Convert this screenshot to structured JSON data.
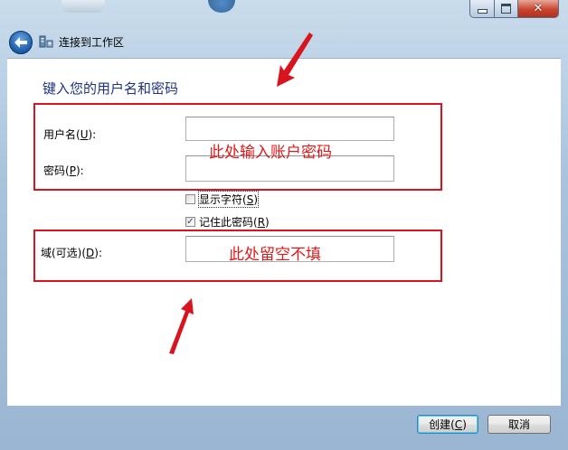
{
  "window": {
    "title": "连接到工作区",
    "controls": [
      "minimize",
      "maximize",
      "close"
    ]
  },
  "form": {
    "heading": "键入您的用户名和密码",
    "username": {
      "label_pre": "用户名(",
      "accel": "U",
      "label_post": "):",
      "value": ""
    },
    "password": {
      "label_pre": "密码(",
      "accel": "P",
      "label_post": "):",
      "value": ""
    },
    "show_chars": {
      "label_pre": "显示字符(",
      "accel": "S",
      "label_post": ")",
      "checked": false
    },
    "remember": {
      "label_pre": "记住此密码(",
      "accel": "R",
      "label_post": ")",
      "checked": true
    },
    "domain": {
      "label_pre": "域(可选)(",
      "accel": "D",
      "label_post": "):",
      "value": ""
    }
  },
  "annotations": {
    "note1": "此处输入账户密码",
    "note2": "此处留空不填",
    "color": "#d8141e"
  },
  "buttons": {
    "create": {
      "label_pre": "创建(",
      "accel": "C",
      "label_post": ")"
    },
    "cancel": "取消"
  },
  "icons": {
    "back": "back-arrow-icon",
    "wizard": "network-workplace-icon",
    "checkmark": "✓"
  }
}
